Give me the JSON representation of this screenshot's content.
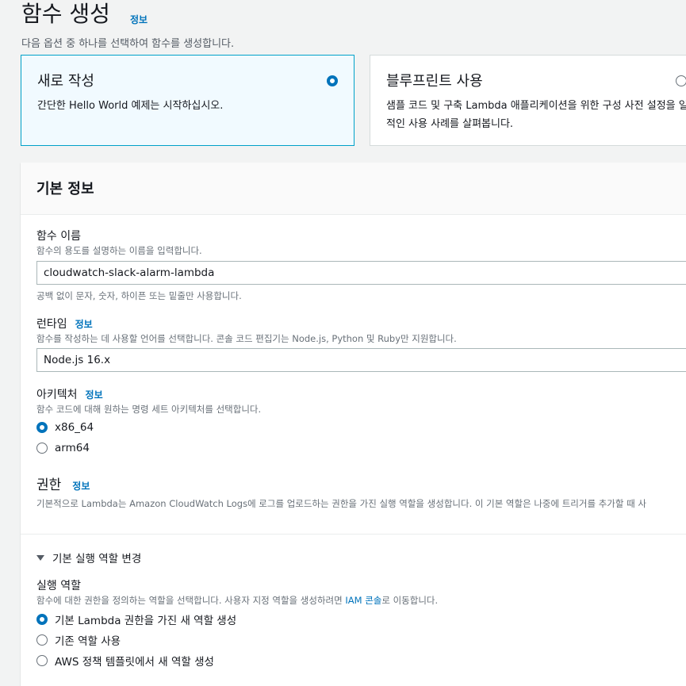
{
  "header": {
    "title": "함수 생성",
    "info": "정보",
    "description": "다음 옵션 중 하나를 선택하여 함수를 생성합니다."
  },
  "options": [
    {
      "title": "새로 작성",
      "description": "간단한 Hello World 예제는 시작하십시오.",
      "selected": true
    },
    {
      "title": "블루프린트 사용",
      "description": "샘플 코드 및 구축 Lambda 애플리케이션을 위한 구성 사전 설정을 일반적인 사용 사례를 살펴봅니다.",
      "selected": false
    }
  ],
  "basic": {
    "title": "기본 정보",
    "function_name": {
      "label": "함수 이름",
      "description": "함수의 용도를 설명하는 이름을 입력합니다.",
      "value": "cloudwatch-slack-alarm-lambda",
      "hint": "공백 없이 문자, 숫자, 하이픈 또는 밑줄만 사용합니다."
    },
    "runtime": {
      "label": "런타임",
      "info": "정보",
      "description": "함수를 작성하는 데 사용할 언어를 선택합니다. 콘솔 코드 편집기는 Node.js, Python 및 Ruby만 지원합니다.",
      "value": "Node.js 16.x"
    },
    "architecture": {
      "label": "아키텍처",
      "info": "정보",
      "description": "함수 코드에 대해 원하는 명령 세트 아키텍처를 선택합니다.",
      "options": [
        "x86_64",
        "arm64"
      ],
      "selected": "x86_64"
    },
    "permissions": {
      "title": "권한",
      "info": "정보",
      "description": "기본적으로 Lambda는 Amazon CloudWatch Logs에 로그를 업로드하는 권한을 가진 실행 역할을 생성합니다. 이 기본 역할은 나중에 트리거를 추가할 때 사"
    },
    "execution_role": {
      "expander_label": "기본 실행 역할 변경",
      "label": "실행 역할",
      "description_pre": "함수에 대한 권한을 정의하는 역할을 선택합니다. 사용자 지정 역할을 생성하려면 ",
      "description_link": "IAM 콘솔",
      "description_post": "로 이동합니다.",
      "options": [
        "기본 Lambda 권한을 가진 새 역할 생성",
        "기존 역할 사용",
        "AWS 정책 템플릿에서 새 역할 생성"
      ],
      "selected": "기본 Lambda 권한을 가진 새 역할 생성"
    }
  },
  "colors": {
    "accent": "#0073bb",
    "selected_card_bg": "#f1faff",
    "selected_card_border": "#00a1c9"
  }
}
